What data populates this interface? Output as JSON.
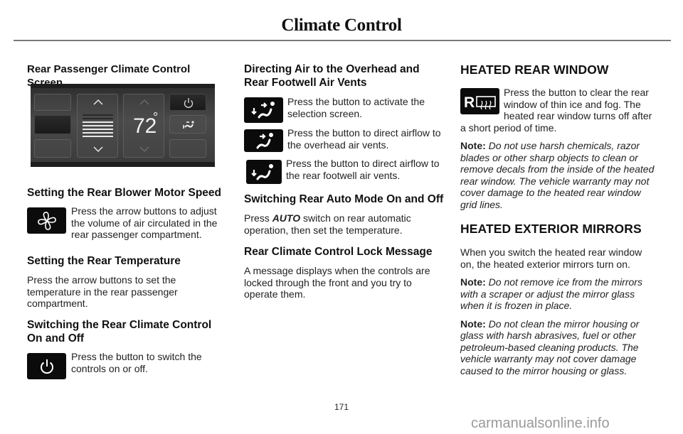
{
  "header": {
    "title": "Climate Control"
  },
  "column1": {
    "screen_heading": "Rear Passenger Climate Control Screen",
    "screen": {
      "temperature": "72",
      "degree": "°"
    },
    "blower_heading": "Setting the Rear Blower Motor Speed",
    "blower_text": "Press the arrow buttons to adjust the volume of air circulated in the rear passenger compartment.",
    "temp_heading": "Setting the Rear Temperature",
    "temp_text": "Press the arrow buttons to set the temperature in the rear passenger compartment.",
    "onoff_heading": "Switching the Rear Climate Control On and Off",
    "onoff_text": "Press the button to switch the controls on or off.",
    "icons": {
      "fan": "fan-icon",
      "power": "power-icon"
    }
  },
  "column2": {
    "vents_heading": "Directing Air to the Overhead and Rear Footwell Air Vents",
    "vent_items": [
      {
        "icon": "overhead-and-footwell-airflow-icon",
        "text": "Press the button to activate the selection screen."
      },
      {
        "icon": "overhead-airflow-icon",
        "text": "Press the button to direct airflow to the overhead air vents."
      },
      {
        "icon": "footwell-airflow-icon",
        "text": "Press the button to direct airflow to the rear footwell air vents."
      }
    ],
    "auto_heading": "Switching Rear Auto Mode On and Off",
    "auto_text_prefix": "Press ",
    "auto_text_bold": "AUTO",
    "auto_text_suffix": " switch on rear automatic operation, then set the temperature.",
    "lock_heading": "Rear Climate Control Lock Message",
    "lock_text": "A message displays when the controls are locked through the front and you try to operate them."
  },
  "column3": {
    "rear_window_heading": "HEATED REAR WINDOW",
    "rear_window_icon": "heated-rear-window-icon",
    "rear_window_icon_letter": "R",
    "rear_window_text": "Press the button to clear the rear window of thin ice and fog.  The heated rear window turns off after a short period of time.",
    "rear_window_note_label": "Note:",
    "rear_window_note": " Do not use harsh chemicals, razor blades or other sharp objects to clean or remove decals from the inside of the heated rear window. The vehicle warranty may not cover damage to the heated rear window grid lines.",
    "mirrors_heading": "HEATED EXTERIOR MIRRORS",
    "mirrors_text": "When you switch the heated rear window on, the heated exterior mirrors turn on.",
    "mirrors_note1_label": "Note:",
    "mirrors_note1": " Do not remove ice from the mirrors with a scraper or adjust the mirror glass when it is frozen in place.",
    "mirrors_note2_label": "Note:",
    "mirrors_note2": " Do not clean the mirror housing or glass with harsh abrasives, fuel or other petroleum-based cleaning products. The vehicle warranty may not cover damage caused to the mirror housing or glass."
  },
  "footer": {
    "page_number": "171",
    "watermark": "carmanualsonline.info"
  }
}
